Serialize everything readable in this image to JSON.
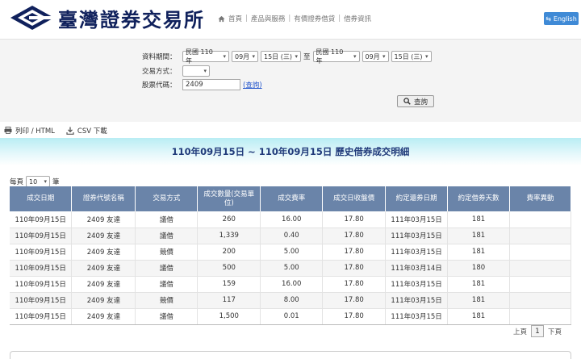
{
  "header": {
    "logo_text": "臺灣證券交易所",
    "breadcrumb": [
      "首頁",
      "產品與服務",
      "有價證券借貸",
      "借券資訊"
    ],
    "lang_button": "English"
  },
  "form": {
    "period_label": "資料期間：",
    "start": {
      "era": "民國 110 年",
      "month": "09月",
      "day": "15日 (三)"
    },
    "to_label": "至",
    "end": {
      "era": "民國 110 年",
      "month": "09月",
      "day": "15日 (三)"
    },
    "trade_type_label": "交易方式：",
    "trade_type_value": "",
    "stock_code_label": "股票代碼：",
    "stock_code_value": "2409",
    "lookup_link": "(查詢)",
    "query_button": "查詢"
  },
  "toolbar": {
    "print_label": "列印 / HTML",
    "csv_label": "CSV 下載"
  },
  "report_title": "110年09月15日 ~ 110年09月15日 歷史借券成交明細",
  "perpage": {
    "prefix": "每頁",
    "value": "10",
    "suffix": "筆"
  },
  "table": {
    "headers": [
      "成交日期",
      "證券代號名稱",
      "交易方式",
      "成交數量(交易單位)",
      "成交費率",
      "成交日收盤價",
      "約定還券日期",
      "約定借券天數",
      "費率異動"
    ],
    "rows": [
      [
        "110年09月15日",
        "2409 友達",
        "議借",
        "260",
        "16.00",
        "17.80",
        "111年03月15日",
        "181",
        ""
      ],
      [
        "110年09月15日",
        "2409 友達",
        "議借",
        "1,339",
        "0.40",
        "17.80",
        "111年03月15日",
        "181",
        ""
      ],
      [
        "110年09月15日",
        "2409 友達",
        "競價",
        "200",
        "5.00",
        "17.80",
        "111年03月15日",
        "181",
        ""
      ],
      [
        "110年09月15日",
        "2409 友達",
        "議借",
        "500",
        "5.00",
        "17.80",
        "111年03月14日",
        "180",
        ""
      ],
      [
        "110年09月15日",
        "2409 友達",
        "議借",
        "159",
        "16.00",
        "17.80",
        "111年03月15日",
        "181",
        ""
      ],
      [
        "110年09月15日",
        "2409 友達",
        "競價",
        "117",
        "8.00",
        "17.80",
        "111年03月15日",
        "181",
        ""
      ],
      [
        "110年09月15日",
        "2409 友達",
        "議借",
        "1,500",
        "0.01",
        "17.80",
        "111年03月15日",
        "181",
        ""
      ]
    ]
  },
  "pager": {
    "prev": "上頁",
    "current": "1",
    "next": "下頁"
  },
  "colors": {
    "header_row": "#6a84a9",
    "title": "#203a7a",
    "accent": "#3f8ad6",
    "brand": "#10215c"
  }
}
